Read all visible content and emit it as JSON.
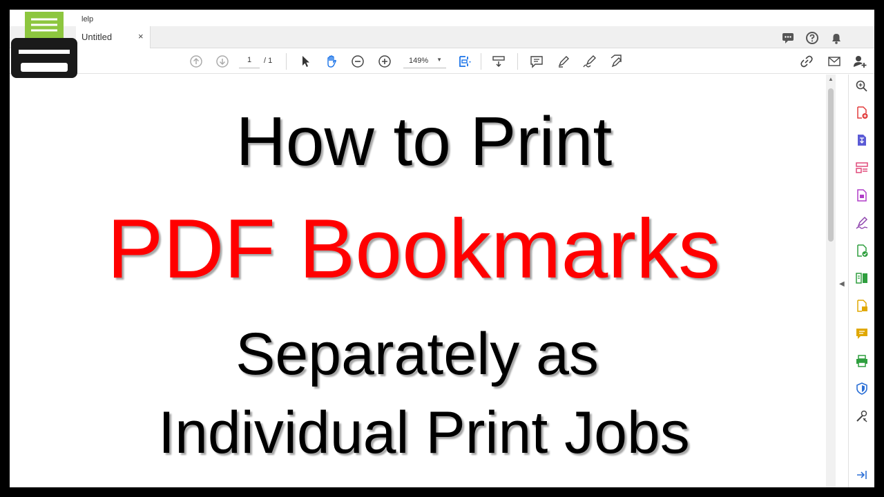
{
  "menu": {
    "help_partial": "lelp"
  },
  "tab": {
    "title": "Untitled",
    "close": "×"
  },
  "toolbar": {
    "page_current": "1",
    "page_total": "/ 1",
    "zoom": "149%"
  },
  "headline": {
    "line1": "How to Print",
    "line2": "PDF Bookmarks",
    "line3": "Separately as",
    "line4": "Individual Print Jobs"
  },
  "colors": {
    "accent_red": "#ff0000",
    "logo_green": "#8dc63f",
    "tool_blue": "#2b6fd6",
    "tool_purple": "#8e44ad",
    "tool_green": "#2e9e3e",
    "tool_yellow": "#e0a800"
  },
  "icons": {
    "top_right": [
      "comment-icon",
      "help-icon",
      "bell-icon"
    ],
    "toolbar": [
      "page-up-icon",
      "page-down-icon",
      "select-arrow-icon",
      "hand-icon",
      "zoom-out-icon",
      "zoom-in-icon",
      "fit-page-icon",
      "scroll-mode-icon",
      "comment-icon",
      "highlight-pen-icon",
      "sign-icon",
      "edit-icon",
      "share-link-icon",
      "email-icon",
      "add-user-icon"
    ],
    "tools_pane": [
      "search-zoom-icon",
      "create-pdf-icon",
      "export-pdf-icon",
      "organize-pages-icon",
      "edit-pdf-icon",
      "fill-sign-icon",
      "send-signature-icon",
      "compare-icon",
      "scan-ocr-icon",
      "comment-icon",
      "print-production-icon",
      "protect-icon",
      "more-tools-icon",
      "collapse-pane-icon"
    ]
  }
}
